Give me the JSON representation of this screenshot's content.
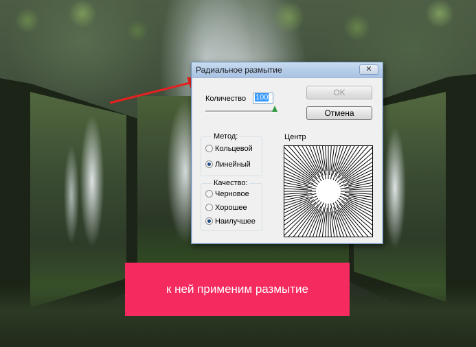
{
  "dialog": {
    "title": "Радиальное размытие",
    "close_icon": "close-icon",
    "amount_label": "Количество",
    "amount_value": "100",
    "ok_label": "OK",
    "cancel_label": "Отмена",
    "method_label": "Метод:",
    "method_options": [
      "Кольцевой",
      "Линейный"
    ],
    "method_selected": "Линейный",
    "quality_label": "Качество:",
    "quality_options": [
      "Черновое",
      "Хорошее",
      "Наилучшее"
    ],
    "quality_selected": "Наилучшее",
    "center_label": "Центр"
  },
  "caption": {
    "text": "к ней применим размытие"
  },
  "colors": {
    "caption_bg": "#f52a5f",
    "arrow": "#e8201f",
    "slider_thumb": "#2e9a3e"
  }
}
